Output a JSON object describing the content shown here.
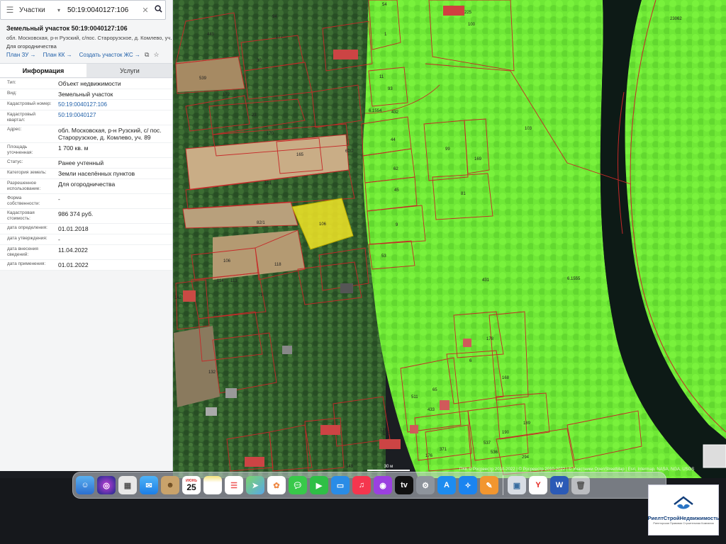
{
  "search": {
    "type_label": "Участки",
    "query": "50:19:0040127:106"
  },
  "object": {
    "title": "Земельный участок 50:19:0040127:106",
    "address_short": "обл. Московская, р-н Рузский, с/пос. Старорузское, д. Комлево, уч. 89",
    "use_short": "Для огородничества",
    "links": [
      "План ЗУ →",
      "План КК →",
      "Создать участок ЖС →"
    ]
  },
  "tabs": [
    "Информация",
    "Услуги"
  ],
  "info_rows": [
    {
      "key": "Тип:",
      "value": "Объект недвижимости",
      "link": false
    },
    {
      "key": "Вид:",
      "value": "Земельный участок",
      "link": false
    },
    {
      "key": "Кадастровый номер:",
      "value": "50:19:0040127:106",
      "link": true
    },
    {
      "key": "Кадастровый квартал:",
      "value": "50:19:0040127",
      "link": true
    },
    {
      "key": "Адрес:",
      "value": "обл. Московская, р-н Рузский, с/ пос. Старорузское, д. Комлево, уч. 89",
      "link": false
    },
    {
      "key": "Площадь уточненная:",
      "value": "1 700 кв. м",
      "link": false
    },
    {
      "key": "Статус:",
      "value": "Ранее учтенный",
      "link": false
    },
    {
      "key": "Категория земель:",
      "value": "Земли населённых пунктов",
      "link": false
    },
    {
      "key": "Разрешенное использование:",
      "value": "Для огородничества",
      "link": false
    },
    {
      "key": "Форма собственности:",
      "value": "-",
      "link": false
    },
    {
      "key": "Кадастровая стоимость:",
      "value": "986 374 руб.",
      "link": false
    },
    {
      "key": "дата определения:",
      "value": "01.01.2018",
      "link": false
    },
    {
      "key": "дата утверждения:",
      "value": "-",
      "link": false
    },
    {
      "key": "дата внесения сведений:",
      "value": "11.04.2022",
      "link": false
    },
    {
      "key": "дата применения:",
      "value": "01.01.2022",
      "link": false
    }
  ],
  "map": {
    "plot_labels": [
      "449",
      "94",
      "177",
      "539",
      "30",
      "172",
      "23",
      "170",
      "165",
      "101",
      "82/1",
      "106",
      "118",
      "114",
      "113",
      "79",
      "143",
      "142",
      "132",
      "62/2",
      "11",
      "93",
      "432",
      "44",
      "62",
      "45",
      "9",
      "53",
      "431",
      "6.1554",
      "6.1555",
      "99",
      "169",
      "81",
      "103",
      "100",
      "225",
      "23062",
      "6",
      "178",
      "168",
      "511",
      "65",
      "433",
      "537",
      "190",
      "189",
      "536",
      "294",
      "371",
      "176",
      "125",
      "127",
      "149",
      "54",
      "1"
    ],
    "highlight_label": "106",
    "scale_label": "30 м",
    "attribution": "ПКК © Росреестр 2010-2022 | © Росреестр 2010-2022 | © Участники OpenStreetMap | Esri, Intermap, NASA, NGA, USGS"
  },
  "dock": {
    "calendar_month": "ИЮНЬ",
    "calendar_day": "25",
    "apps": [
      "finder-icon",
      "siri-icon",
      "launchpad-icon",
      "mail-icon",
      "contacts-icon",
      "calendar-icon",
      "notes-icon",
      "reminders-icon",
      "maps-icon",
      "photos-icon",
      "messages-icon",
      "facetime-icon",
      "keynote-icon",
      "music-icon",
      "podcasts-icon",
      "tv-icon",
      "settings-icon",
      "appstore-icon",
      "safari-icon",
      "pages-icon",
      "preview-icon",
      "yandex-icon",
      "word-icon",
      "trash-icon"
    ]
  },
  "watermark": {
    "name": "РиелтСтройНедвижимость",
    "sub": "Риелторская Правовая Строительная Компания"
  },
  "colors": {
    "zone_green": "#7cfc3a",
    "boundary_red": "#c62828",
    "highlight_yellow": "#f2e627",
    "river": "#0d1a16",
    "link_blue": "#1f5fa8"
  }
}
